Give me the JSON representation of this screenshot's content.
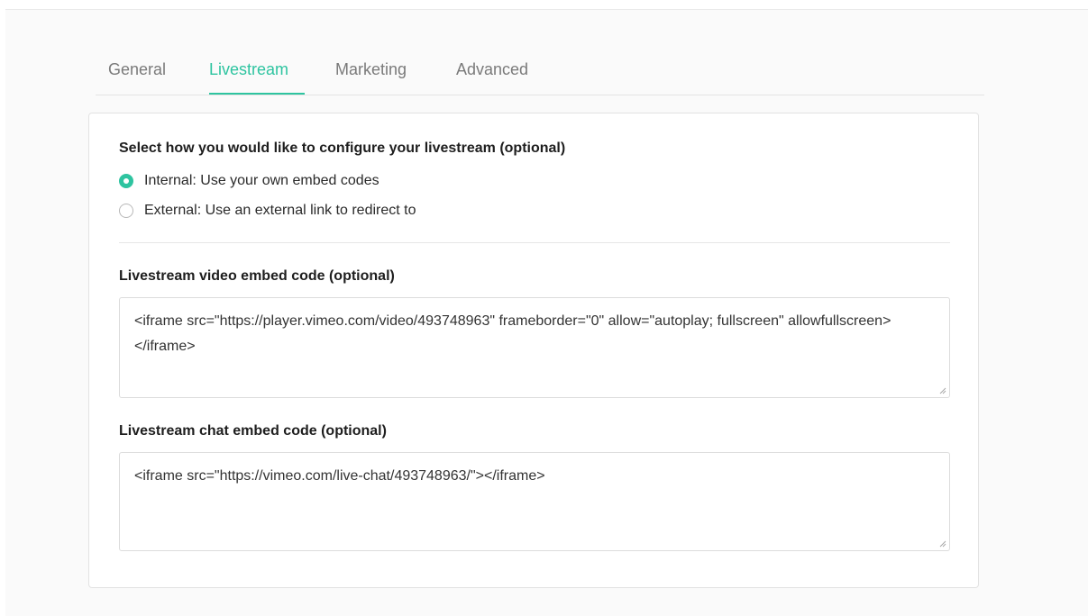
{
  "tabs": [
    {
      "label": "General",
      "active": false
    },
    {
      "label": "Livestream",
      "active": true
    },
    {
      "label": "Marketing",
      "active": false
    },
    {
      "label": "Advanced",
      "active": false
    }
  ],
  "colors": {
    "accent": "#2ec4a0",
    "tab_inactive": "#7a7a7a",
    "spellcheck_underline": "#d9534f"
  },
  "config": {
    "title": "Select how you would like to configure your livestream (optional)",
    "options": [
      {
        "label": "Internal: Use your own embed codes",
        "selected": true
      },
      {
        "label": "External: Use an external link to redirect to",
        "selected": false
      }
    ]
  },
  "video_embed": {
    "label": "Livestream video embed code (optional)",
    "value": "<iframe src=\"https://player.vimeo.com/video/493748963\" frameborder=\"0\" allow=\"autoplay; fullscreen\" allowfullscreen></iframe>"
  },
  "chat_embed": {
    "label": "Livestream chat embed code (optional)",
    "value": "<iframe src=\"https://vimeo.com/live-chat/493748963/\"></iframe>"
  }
}
